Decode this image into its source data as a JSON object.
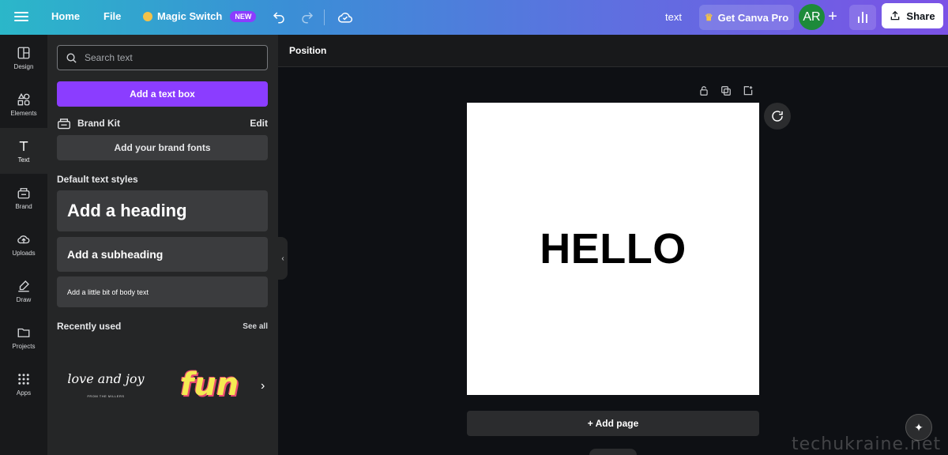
{
  "topbar": {
    "home": "Home",
    "file": "File",
    "magic_switch": "Magic Switch",
    "new_badge": "NEW",
    "doc_name": "text",
    "get_pro": "Get Canva Pro",
    "avatar_initials": "AR",
    "plus": "+",
    "share": "Share"
  },
  "rail": {
    "items": [
      {
        "label": "Design",
        "icon": "design-icon"
      },
      {
        "label": "Elements",
        "icon": "elements-icon"
      },
      {
        "label": "Text",
        "icon": "text-icon"
      },
      {
        "label": "Brand",
        "icon": "brand-icon"
      },
      {
        "label": "Uploads",
        "icon": "uploads-icon"
      },
      {
        "label": "Draw",
        "icon": "draw-icon"
      },
      {
        "label": "Projects",
        "icon": "projects-icon"
      },
      {
        "label": "Apps",
        "icon": "apps-icon"
      }
    ],
    "active": "Text"
  },
  "panel": {
    "search_placeholder": "Search text",
    "add_text_box": "Add a text box",
    "brand_kit": "Brand Kit",
    "edit": "Edit",
    "add_brand_fonts": "Add your brand fonts",
    "default_styles_title": "Default text styles",
    "heading": "Add a heading",
    "subheading": "Add a subheading",
    "body": "Add a little bit of body text",
    "recently_used": "Recently used",
    "see_all": "See all",
    "recent": [
      {
        "main": "love and joy",
        "sub": "FROM THE MILLERS"
      },
      {
        "main": "fun"
      }
    ]
  },
  "editor": {
    "context_label": "Position",
    "canvas_text": "HELLO",
    "add_page": "+ Add page",
    "watermark": "techukraine.net"
  },
  "colors": {
    "accent": "#8b3dff",
    "panel_bg": "#252627",
    "rail_bg": "#18191b",
    "editor_bg": "#0e1014"
  }
}
